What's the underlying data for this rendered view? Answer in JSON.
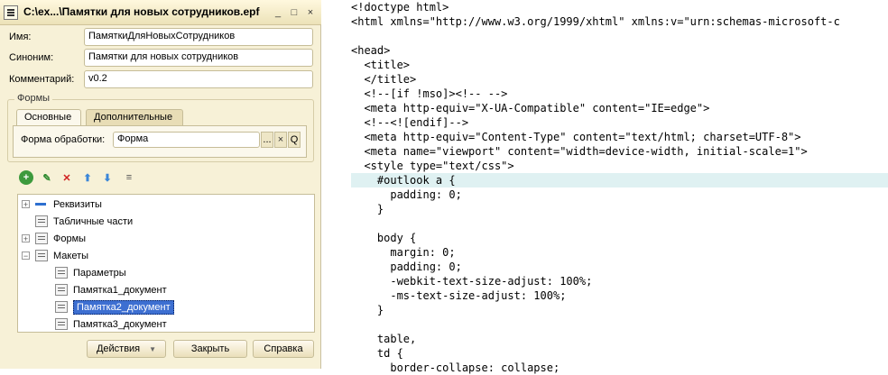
{
  "window": {
    "title": "C:\\ex...\\Памятки для новых сотрудников.epf",
    "minimize": "_",
    "maximize": "□",
    "close": "×"
  },
  "fields": {
    "name_label": "Имя:",
    "name_value": "ПамяткиДляНовыхСотрудников",
    "synonym_label": "Синоним:",
    "synonym_value": "Памятки для новых сотрудников",
    "comment_label": "Комментарий:",
    "comment_value": "v0.2"
  },
  "forms": {
    "legend": "Формы",
    "tab_main": "Основные",
    "tab_extra": "Дополнительные",
    "processing_form_label": "Форма обработки:",
    "processing_form_value": "Форма",
    "dots": "...",
    "clear": "×",
    "search": "Q"
  },
  "toolbar": {
    "add": "+",
    "edit": "✎",
    "delete": "✕",
    "up": "⬆",
    "down": "⬇",
    "list": "≡"
  },
  "tree": {
    "items": [
      {
        "label": "Реквизиты",
        "expander": "+"
      },
      {
        "label": "Табличные части",
        "expander": ""
      },
      {
        "label": "Формы",
        "expander": "+"
      },
      {
        "label": "Макеты",
        "expander": "−"
      },
      {
        "label": "Параметры"
      },
      {
        "label": "Памятка1_документ"
      },
      {
        "label": "Памятка2_документ"
      },
      {
        "label": "Памятка3_документ"
      }
    ]
  },
  "buttons": {
    "actions": "Действия",
    "actions_arrow": "▼",
    "close": "Закрыть",
    "help": "Справка"
  },
  "code": {
    "lines": [
      "<!doctype html>",
      "<html xmlns=\"http://www.w3.org/1999/xhtml\" xmlns:v=\"urn:schemas-microsoft-c",
      "",
      "<head>",
      "  <title>",
      "  </title>",
      "  <!--[if !mso]><!-- -->",
      "  <meta http-equiv=\"X-UA-Compatible\" content=\"IE=edge\">",
      "  <!--<![endif]-->",
      "  <meta http-equiv=\"Content-Type\" content=\"text/html; charset=UTF-8\">",
      "  <meta name=\"viewport\" content=\"width=device-width, initial-scale=1\">",
      "  <style type=\"text/css\">",
      "    #outlook a {",
      "      padding: 0;",
      "    }",
      "",
      "    body {",
      "      margin: 0;",
      "      padding: 0;",
      "      -webkit-text-size-adjust: 100%;",
      "      -ms-text-size-adjust: 100%;",
      "    }",
      "",
      "    table,",
      "    td {",
      "      border-collapse: collapse;"
    ]
  }
}
